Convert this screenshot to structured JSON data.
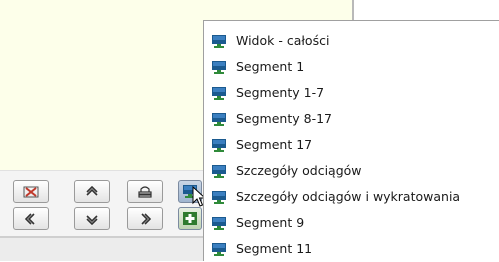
{
  "context_menu": {
    "items": [
      {
        "label": "Widok - całości",
        "icon": "monitor-icon"
      },
      {
        "label": "Segment 1",
        "icon": "monitor-icon"
      },
      {
        "label": "Segmenty 1-7",
        "icon": "monitor-icon"
      },
      {
        "label": "Segmenty 8-17",
        "icon": "monitor-icon"
      },
      {
        "label": "Segment 17",
        "icon": "monitor-icon"
      },
      {
        "label": "Szczegóły odciągów",
        "icon": "monitor-icon"
      },
      {
        "label": "Szczegóły odciągów i wykratowania",
        "icon": "monitor-icon"
      },
      {
        "label": "Segment 9",
        "icon": "monitor-icon"
      },
      {
        "label": "Segment 11",
        "icon": "monitor-icon"
      }
    ]
  },
  "toolbar": {
    "buttons": [
      {
        "name": "zoom-extents-button",
        "icon": "zoom-extents-icon"
      },
      {
        "name": "pan-up-button",
        "icon": "chevron-up-icon"
      },
      {
        "name": "plan-view-button",
        "icon": "plan-view-icon"
      },
      {
        "name": "saved-views-button",
        "icon": "monitor-icon"
      },
      {
        "name": "pan-left-button",
        "icon": "chevron-left-icon"
      },
      {
        "name": "pan-down-button",
        "icon": "chevron-down-icon"
      },
      {
        "name": "pan-right-button",
        "icon": "chevron-right-icon"
      },
      {
        "name": "add-view-button",
        "icon": "add-view-icon"
      }
    ]
  },
  "colors": {
    "canvas_background": "#fdffea",
    "monitor_screen": "#1b5a8f",
    "monitor_stand": "#2f8a3a",
    "menu_background": "#ffffff"
  }
}
